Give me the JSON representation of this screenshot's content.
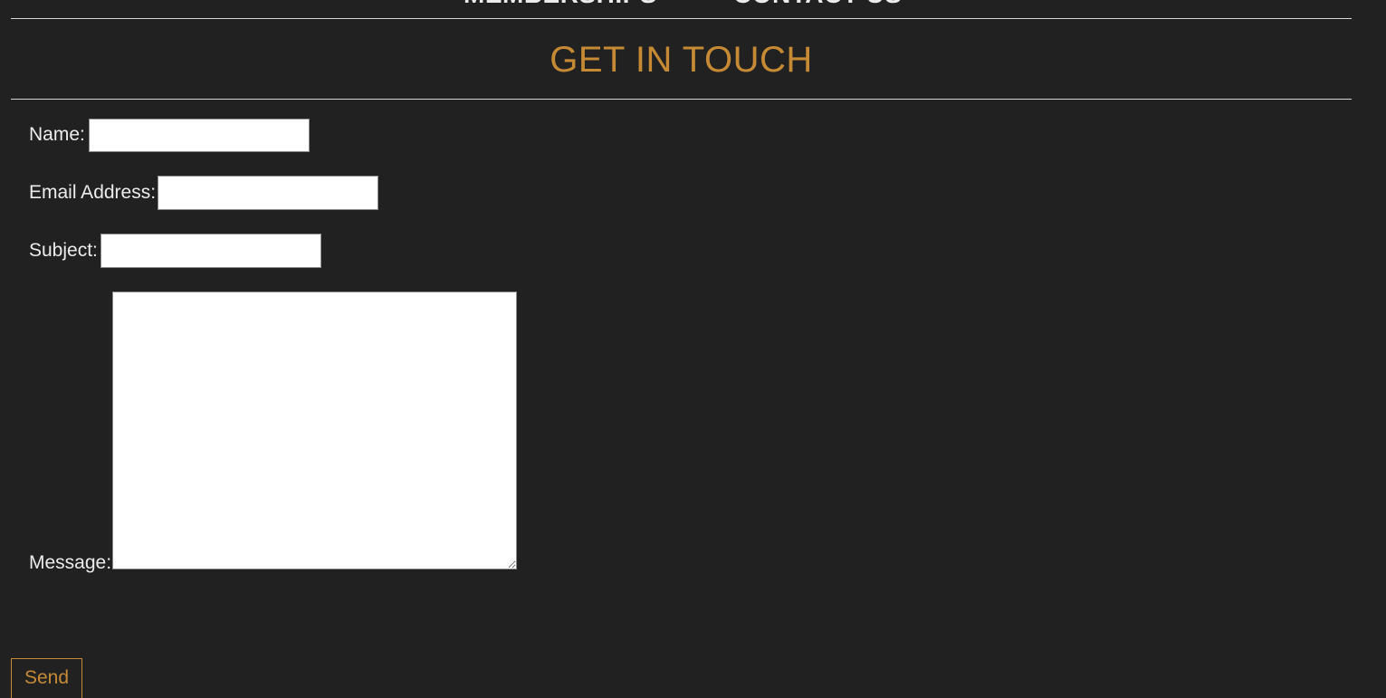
{
  "nav": {
    "memberships_label": "MEMBERSHIPS",
    "contact_label": "CONTACT US"
  },
  "heading": "GET IN TOUCH",
  "form": {
    "name_label": "Name:",
    "name_value": "",
    "email_label": "Email Address:",
    "email_value": "",
    "subject_label": "Subject:",
    "subject_value": "",
    "message_label": "Message:",
    "message_value": "",
    "send_label": "Send"
  },
  "colors": {
    "background": "#212121",
    "accent": "#c68a35",
    "text": "#ececec"
  }
}
